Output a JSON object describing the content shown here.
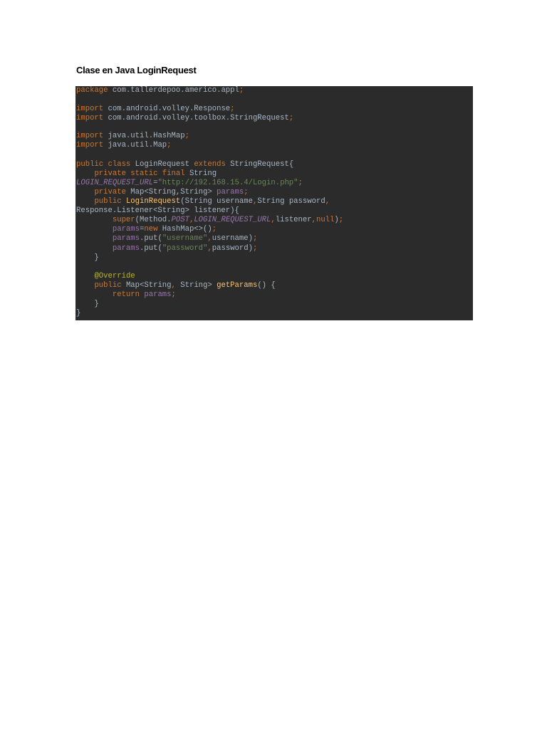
{
  "heading": "Clase en Java LoginRequest",
  "code": {
    "language": "Java",
    "theme_colors": {
      "background": "#2b2b2b",
      "text": "#a9b7c6",
      "keyword": "#cc7832",
      "string": "#6a8759",
      "field": "#9876aa",
      "method": "#ffc66d",
      "annotation": "#bbb529"
    },
    "lines": [
      [
        {
          "c": "k",
          "t": "package"
        },
        {
          "c": "t",
          "t": " com.tallerdepoo.americo.appl"
        },
        {
          "c": "k",
          "t": ";"
        }
      ],
      [],
      [
        {
          "c": "k",
          "t": "import"
        },
        {
          "c": "t",
          "t": " com.android.volley.Response"
        },
        {
          "c": "k",
          "t": ";"
        }
      ],
      [
        {
          "c": "k",
          "t": "import"
        },
        {
          "c": "t",
          "t": " com.android.volley.toolbox.StringRequest"
        },
        {
          "c": "k",
          "t": ";"
        }
      ],
      [],
      [
        {
          "c": "k",
          "t": "import"
        },
        {
          "c": "t",
          "t": " java.util.HashMap"
        },
        {
          "c": "k",
          "t": ";"
        }
      ],
      [
        {
          "c": "k",
          "t": "import"
        },
        {
          "c": "t",
          "t": " java.util.Map"
        },
        {
          "c": "k",
          "t": ";"
        }
      ],
      [],
      [
        {
          "c": "k",
          "t": "public class"
        },
        {
          "c": "t",
          "t": " LoginRequest "
        },
        {
          "c": "k",
          "t": "extends"
        },
        {
          "c": "t",
          "t": " StringRequest{"
        }
      ],
      [
        {
          "c": "t",
          "t": "    "
        },
        {
          "c": "k",
          "t": "private static final"
        },
        {
          "c": "t",
          "t": " String"
        }
      ],
      [
        {
          "c": "fi",
          "t": "LOGIN_REQUEST_URL"
        },
        {
          "c": "t",
          "t": "="
        },
        {
          "c": "s",
          "t": "\"http://192.168.15.4/Login.php\""
        },
        {
          "c": "k",
          "t": ";"
        }
      ],
      [
        {
          "c": "t",
          "t": "    "
        },
        {
          "c": "k",
          "t": "private"
        },
        {
          "c": "t",
          "t": " Map<String,String> "
        },
        {
          "c": "f",
          "t": "params"
        },
        {
          "c": "k",
          "t": ";"
        }
      ],
      [
        {
          "c": "t",
          "t": "    "
        },
        {
          "c": "k",
          "t": "public"
        },
        {
          "c": "t",
          "t": " "
        },
        {
          "c": "m",
          "t": "LoginRequest"
        },
        {
          "c": "t",
          "t": "(String username"
        },
        {
          "c": "k",
          "t": ","
        },
        {
          "c": "t",
          "t": "String password"
        },
        {
          "c": "k",
          "t": ","
        }
      ],
      [
        {
          "c": "t",
          "t": "Response.Listener<String> listener){"
        }
      ],
      [
        {
          "c": "t",
          "t": "        "
        },
        {
          "c": "k",
          "t": "super"
        },
        {
          "c": "t",
          "t": "(Method."
        },
        {
          "c": "fi",
          "t": "POST"
        },
        {
          "c": "k",
          "t": ","
        },
        {
          "c": "fi",
          "t": "LOGIN_REQUEST_URL"
        },
        {
          "c": "k",
          "t": ","
        },
        {
          "c": "t",
          "t": "listener"
        },
        {
          "c": "k",
          "t": ","
        },
        {
          "c": "k",
          "t": "null"
        },
        {
          "c": "t",
          "t": ")"
        },
        {
          "c": "k",
          "t": ";"
        }
      ],
      [
        {
          "c": "t",
          "t": "        "
        },
        {
          "c": "f",
          "t": "params"
        },
        {
          "c": "t",
          "t": "="
        },
        {
          "c": "k",
          "t": "new"
        },
        {
          "c": "t",
          "t": " HashMap<>()"
        },
        {
          "c": "k",
          "t": ";"
        }
      ],
      [
        {
          "c": "t",
          "t": "        "
        },
        {
          "c": "f",
          "t": "params"
        },
        {
          "c": "t",
          "t": ".put("
        },
        {
          "c": "s",
          "t": "\"username\""
        },
        {
          "c": "k",
          "t": ","
        },
        {
          "c": "t",
          "t": "username)"
        },
        {
          "c": "k",
          "t": ";"
        }
      ],
      [
        {
          "c": "t",
          "t": "        "
        },
        {
          "c": "f",
          "t": "params"
        },
        {
          "c": "t",
          "t": ".put("
        },
        {
          "c": "s",
          "t": "\"password\""
        },
        {
          "c": "k",
          "t": ","
        },
        {
          "c": "t",
          "t": "password)"
        },
        {
          "c": "k",
          "t": ";"
        }
      ],
      [
        {
          "c": "t",
          "t": "    }"
        }
      ],
      [],
      [
        {
          "c": "t",
          "t": "    "
        },
        {
          "c": "a",
          "t": "@Override"
        }
      ],
      [
        {
          "c": "t",
          "t": "    "
        },
        {
          "c": "k",
          "t": "public"
        },
        {
          "c": "t",
          "t": " Map<String"
        },
        {
          "c": "k",
          "t": ","
        },
        {
          "c": "t",
          "t": " String> "
        },
        {
          "c": "m",
          "t": "getParams"
        },
        {
          "c": "t",
          "t": "() {"
        }
      ],
      [
        {
          "c": "t",
          "t": "        "
        },
        {
          "c": "k",
          "t": "return"
        },
        {
          "c": "t",
          "t": " "
        },
        {
          "c": "f",
          "t": "params"
        },
        {
          "c": "k",
          "t": ";"
        }
      ],
      [
        {
          "c": "t",
          "t": "    }"
        }
      ],
      [
        {
          "c": "t",
          "t": "}"
        }
      ]
    ]
  }
}
